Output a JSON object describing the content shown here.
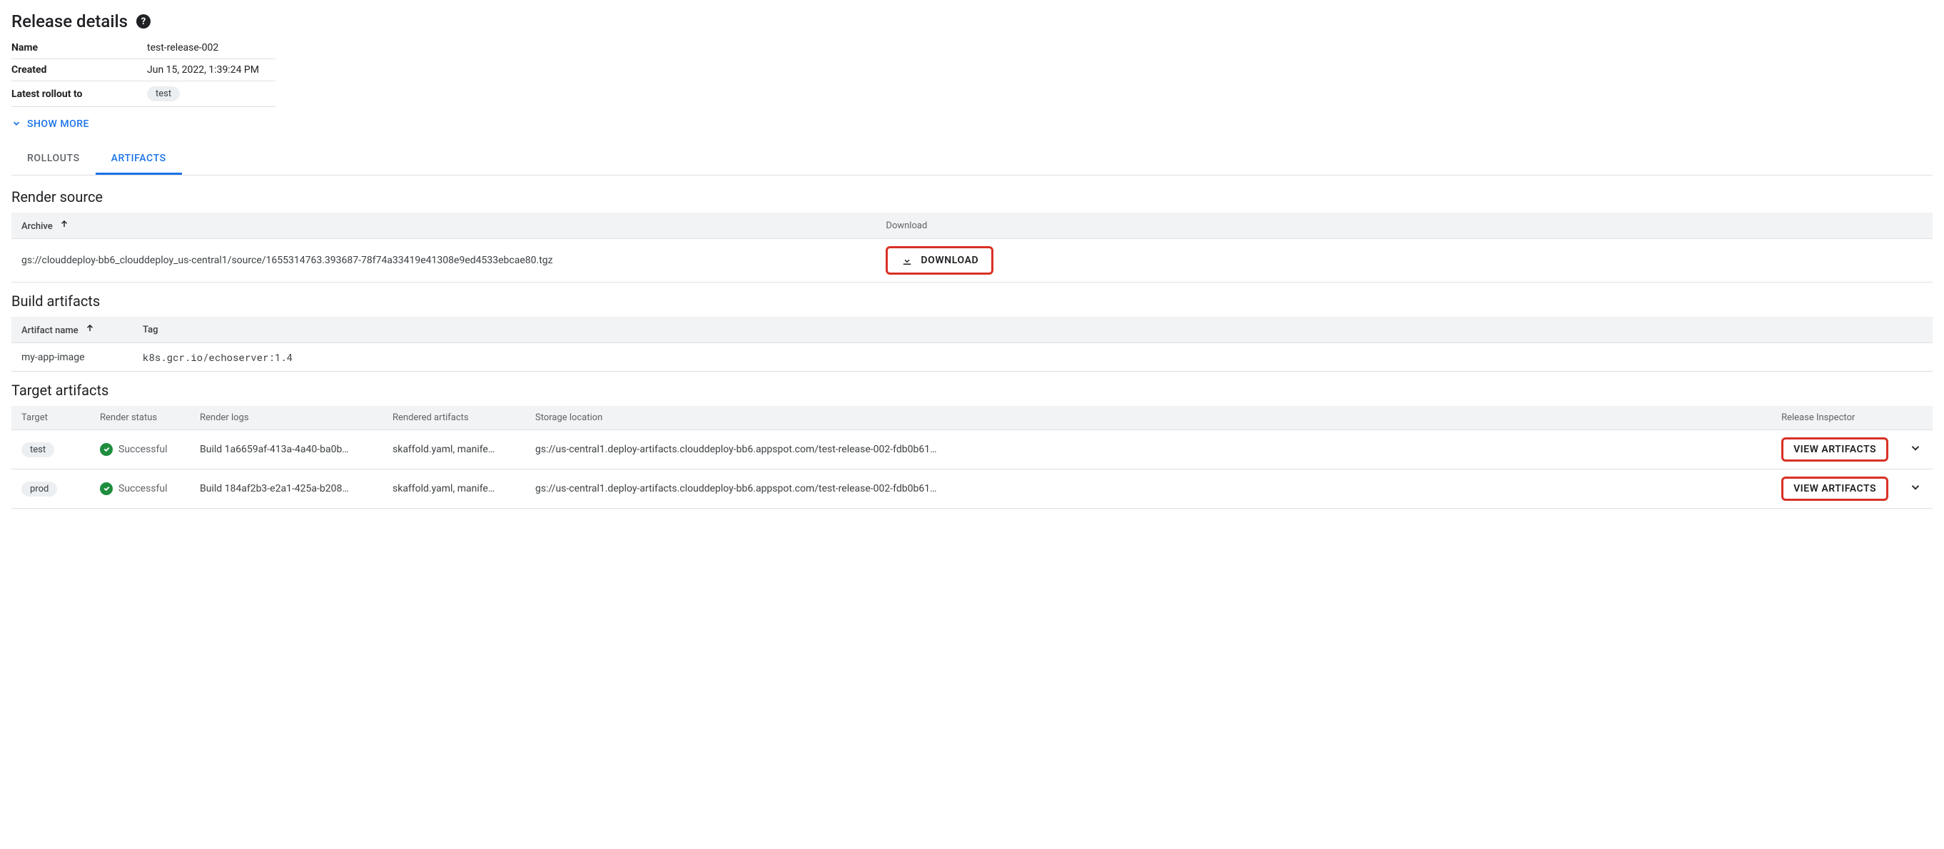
{
  "header": {
    "title": "Release details"
  },
  "details": {
    "rows": [
      {
        "key": "Name",
        "value": "test-release-002",
        "chip": false
      },
      {
        "key": "Created",
        "value": "Jun 15, 2022, 1:39:24 PM",
        "chip": false
      },
      {
        "key": "Latest rollout to",
        "value": "test",
        "chip": true
      }
    ],
    "show_more": "SHOW MORE"
  },
  "tabs": {
    "items": [
      {
        "label": "ROLLOUTS",
        "active": false
      },
      {
        "label": "ARTIFACTS",
        "active": true
      }
    ]
  },
  "render_source": {
    "title": "Render source",
    "columns": {
      "archive": "Archive",
      "download": "Download"
    },
    "rows": [
      {
        "archive": "gs://clouddeploy-bb6_clouddeploy_us-central1/source/1655314763.393687-78f74a33419e41308e9ed4533ebcae80.tgz",
        "download_label": "DOWNLOAD"
      }
    ]
  },
  "build_artifacts": {
    "title": "Build artifacts",
    "columns": {
      "name": "Artifact name",
      "tag": "Tag"
    },
    "rows": [
      {
        "name": "my-app-image",
        "tag": "k8s.gcr.io/echoserver:1.4"
      }
    ]
  },
  "target_artifacts": {
    "title": "Target artifacts",
    "columns": {
      "target": "Target",
      "render_status": "Render status",
      "render_logs": "Render logs",
      "rendered_artifacts": "Rendered artifacts",
      "storage_location": "Storage location",
      "release_inspector": "Release Inspector"
    },
    "status_label": "Successful",
    "view_label": "VIEW ARTIFACTS",
    "rows": [
      {
        "target": "test",
        "render_logs": "Build 1a6659af-413a-4a40-ba0b…",
        "rendered_artifacts": "skaffold.yaml, manife…",
        "storage_location": "gs://us-central1.deploy-artifacts.clouddeploy-bb6.appspot.com/test-release-002-fdb0b61…"
      },
      {
        "target": "prod",
        "render_logs": "Build 184af2b3-e2a1-425a-b208…",
        "rendered_artifacts": "skaffold.yaml, manife…",
        "storage_location": "gs://us-central1.deploy-artifacts.clouddeploy-bb6.appspot.com/test-release-002-fdb0b61…"
      }
    ]
  }
}
